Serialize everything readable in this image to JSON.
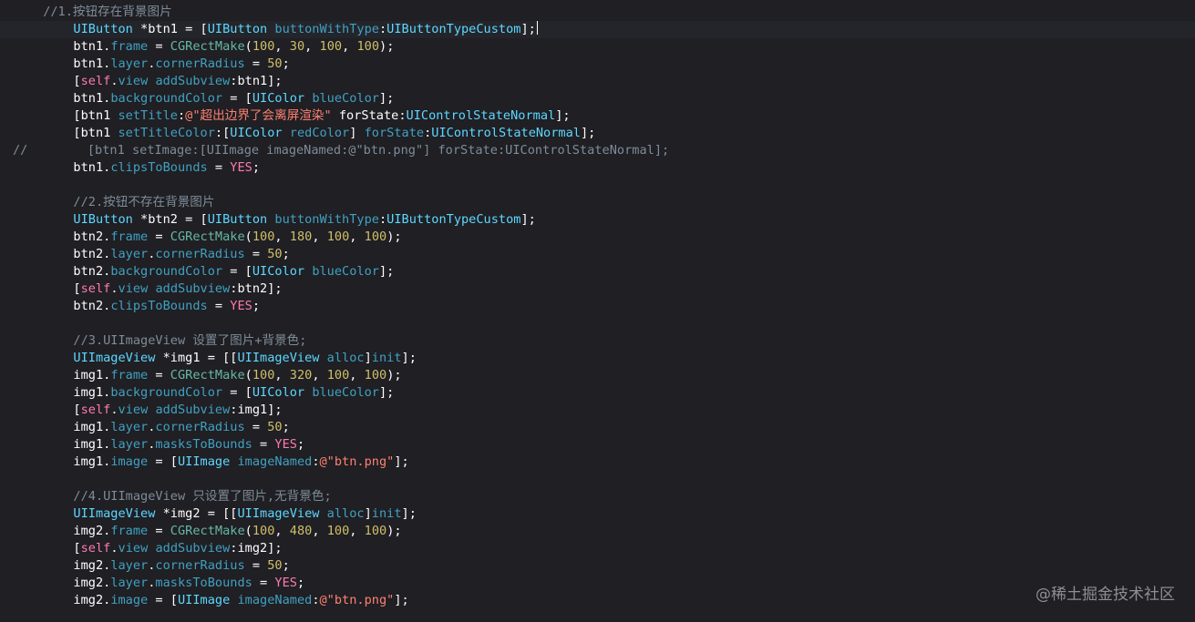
{
  "colors": {
    "background": "#1f1f24",
    "plain": "#ffffff",
    "type": "#5dd8ff",
    "project": "#41a1c0",
    "number": "#d0bf69",
    "keyword": "#ff7ab2",
    "string": "#ff8170",
    "comment": "#7f8c98"
  },
  "lines": [
    {
      "indent": "    ",
      "tokens": [
        {
          "t": "//1.按钮存在背景图片",
          "c": "comment"
        }
      ]
    },
    {
      "indent": "        ",
      "current": true,
      "cursor": true,
      "tokens": [
        {
          "t": "UIButton",
          "c": "type"
        },
        {
          "t": " *btn1 = [",
          "c": "plain"
        },
        {
          "t": "UIButton",
          "c": "type"
        },
        {
          "t": " ",
          "c": "plain"
        },
        {
          "t": "buttonWithType",
          "c": "method"
        },
        {
          "t": ":",
          "c": "plain"
        },
        {
          "t": "UIButtonTypeCustom",
          "c": "type"
        },
        {
          "t": "];",
          "c": "plain"
        }
      ]
    },
    {
      "indent": "        ",
      "tokens": [
        {
          "t": "btn1.",
          "c": "plain"
        },
        {
          "t": "frame",
          "c": "prop"
        },
        {
          "t": " = ",
          "c": "plain"
        },
        {
          "t": "CGRectMake",
          "c": "func"
        },
        {
          "t": "(",
          "c": "plain"
        },
        {
          "t": "100",
          "c": "number"
        },
        {
          "t": ", ",
          "c": "plain"
        },
        {
          "t": "30",
          "c": "number"
        },
        {
          "t": ", ",
          "c": "plain"
        },
        {
          "t": "100",
          "c": "number"
        },
        {
          "t": ", ",
          "c": "plain"
        },
        {
          "t": "100",
          "c": "number"
        },
        {
          "t": ");",
          "c": "plain"
        }
      ]
    },
    {
      "indent": "        ",
      "tokens": [
        {
          "t": "btn1.",
          "c": "plain"
        },
        {
          "t": "layer",
          "c": "prop"
        },
        {
          "t": ".",
          "c": "plain"
        },
        {
          "t": "cornerRadius",
          "c": "prop"
        },
        {
          "t": " = ",
          "c": "plain"
        },
        {
          "t": "50",
          "c": "number"
        },
        {
          "t": ";",
          "c": "plain"
        }
      ]
    },
    {
      "indent": "        ",
      "tokens": [
        {
          "t": "[",
          "c": "plain"
        },
        {
          "t": "self",
          "c": "keyword"
        },
        {
          "t": ".",
          "c": "plain"
        },
        {
          "t": "view",
          "c": "prop"
        },
        {
          "t": " ",
          "c": "plain"
        },
        {
          "t": "addSubview",
          "c": "method"
        },
        {
          "t": ":btn1];",
          "c": "plain"
        }
      ]
    },
    {
      "indent": "        ",
      "tokens": [
        {
          "t": "btn1.",
          "c": "plain"
        },
        {
          "t": "backgroundColor",
          "c": "prop"
        },
        {
          "t": " = [",
          "c": "plain"
        },
        {
          "t": "UIColor",
          "c": "type"
        },
        {
          "t": " ",
          "c": "plain"
        },
        {
          "t": "blueColor",
          "c": "method"
        },
        {
          "t": "];",
          "c": "plain"
        }
      ]
    },
    {
      "indent": "        ",
      "tokens": [
        {
          "t": "[btn1 ",
          "c": "plain"
        },
        {
          "t": "setTitle",
          "c": "method"
        },
        {
          "t": ":",
          "c": "plain"
        },
        {
          "t": "@\"超出边界了会离屏渲染\"",
          "c": "string"
        },
        {
          "t": " forState:",
          "c": "plain"
        },
        {
          "t": "UIControlStateNormal",
          "c": "type"
        },
        {
          "t": "];",
          "c": "plain"
        }
      ]
    },
    {
      "indent": "        ",
      "tokens": [
        {
          "t": "[btn1 ",
          "c": "plain"
        },
        {
          "t": "setTitleColor",
          "c": "method"
        },
        {
          "t": ":[",
          "c": "plain"
        },
        {
          "t": "UIColor",
          "c": "type"
        },
        {
          "t": " ",
          "c": "plain"
        },
        {
          "t": "redColor",
          "c": "method"
        },
        {
          "t": "] ",
          "c": "plain"
        },
        {
          "t": "forState",
          "c": "method"
        },
        {
          "t": ":",
          "c": "plain"
        },
        {
          "t": "UIControlStateNormal",
          "c": "type"
        },
        {
          "t": "];",
          "c": "plain"
        }
      ]
    },
    {
      "indent": "",
      "tokens": [
        {
          "t": "//        [btn1 setImage:[UIImage imageNamed:@\"btn.png\"] forState:UIControlStateNormal];",
          "c": "comment"
        }
      ]
    },
    {
      "indent": "        ",
      "tokens": [
        {
          "t": "btn1.",
          "c": "plain"
        },
        {
          "t": "clipsToBounds",
          "c": "prop"
        },
        {
          "t": " = ",
          "c": "plain"
        },
        {
          "t": "YES",
          "c": "keyword"
        },
        {
          "t": ";",
          "c": "plain"
        }
      ]
    },
    {
      "indent": "",
      "tokens": []
    },
    {
      "indent": "        ",
      "tokens": [
        {
          "t": "//2.按钮不存在背景图片",
          "c": "comment"
        }
      ]
    },
    {
      "indent": "        ",
      "tokens": [
        {
          "t": "UIButton",
          "c": "type"
        },
        {
          "t": " *btn2 = [",
          "c": "plain"
        },
        {
          "t": "UIButton",
          "c": "type"
        },
        {
          "t": " ",
          "c": "plain"
        },
        {
          "t": "buttonWithType",
          "c": "method"
        },
        {
          "t": ":",
          "c": "plain"
        },
        {
          "t": "UIButtonTypeCustom",
          "c": "type"
        },
        {
          "t": "];",
          "c": "plain"
        }
      ]
    },
    {
      "indent": "        ",
      "tokens": [
        {
          "t": "btn2.",
          "c": "plain"
        },
        {
          "t": "frame",
          "c": "prop"
        },
        {
          "t": " = ",
          "c": "plain"
        },
        {
          "t": "CGRectMake",
          "c": "func"
        },
        {
          "t": "(",
          "c": "plain"
        },
        {
          "t": "100",
          "c": "number"
        },
        {
          "t": ", ",
          "c": "plain"
        },
        {
          "t": "180",
          "c": "number"
        },
        {
          "t": ", ",
          "c": "plain"
        },
        {
          "t": "100",
          "c": "number"
        },
        {
          "t": ", ",
          "c": "plain"
        },
        {
          "t": "100",
          "c": "number"
        },
        {
          "t": ");",
          "c": "plain"
        }
      ]
    },
    {
      "indent": "        ",
      "tokens": [
        {
          "t": "btn2.",
          "c": "plain"
        },
        {
          "t": "layer",
          "c": "prop"
        },
        {
          "t": ".",
          "c": "plain"
        },
        {
          "t": "cornerRadius",
          "c": "prop"
        },
        {
          "t": " = ",
          "c": "plain"
        },
        {
          "t": "50",
          "c": "number"
        },
        {
          "t": ";",
          "c": "plain"
        }
      ]
    },
    {
      "indent": "        ",
      "tokens": [
        {
          "t": "btn2.",
          "c": "plain"
        },
        {
          "t": "backgroundColor",
          "c": "prop"
        },
        {
          "t": " = [",
          "c": "plain"
        },
        {
          "t": "UIColor",
          "c": "type"
        },
        {
          "t": " ",
          "c": "plain"
        },
        {
          "t": "blueColor",
          "c": "method"
        },
        {
          "t": "];",
          "c": "plain"
        }
      ]
    },
    {
      "indent": "        ",
      "tokens": [
        {
          "t": "[",
          "c": "plain"
        },
        {
          "t": "self",
          "c": "keyword"
        },
        {
          "t": ".",
          "c": "plain"
        },
        {
          "t": "view",
          "c": "prop"
        },
        {
          "t": " ",
          "c": "plain"
        },
        {
          "t": "addSubview",
          "c": "method"
        },
        {
          "t": ":btn2];",
          "c": "plain"
        }
      ]
    },
    {
      "indent": "        ",
      "tokens": [
        {
          "t": "btn2.",
          "c": "plain"
        },
        {
          "t": "clipsToBounds",
          "c": "prop"
        },
        {
          "t": " = ",
          "c": "plain"
        },
        {
          "t": "YES",
          "c": "keyword"
        },
        {
          "t": ";",
          "c": "plain"
        }
      ]
    },
    {
      "indent": "",
      "tokens": []
    },
    {
      "indent": "        ",
      "tokens": [
        {
          "t": "//3.UIImageView 设置了图片+背景色;",
          "c": "comment"
        }
      ]
    },
    {
      "indent": "        ",
      "tokens": [
        {
          "t": "UIImageView",
          "c": "type"
        },
        {
          "t": " *img1 = [[",
          "c": "plain"
        },
        {
          "t": "UIImageView",
          "c": "type"
        },
        {
          "t": " ",
          "c": "plain"
        },
        {
          "t": "alloc",
          "c": "method"
        },
        {
          "t": "]",
          "c": "plain"
        },
        {
          "t": "init",
          "c": "method"
        },
        {
          "t": "];",
          "c": "plain"
        }
      ]
    },
    {
      "indent": "        ",
      "tokens": [
        {
          "t": "img1.",
          "c": "plain"
        },
        {
          "t": "frame",
          "c": "prop"
        },
        {
          "t": " = ",
          "c": "plain"
        },
        {
          "t": "CGRectMake",
          "c": "func"
        },
        {
          "t": "(",
          "c": "plain"
        },
        {
          "t": "100",
          "c": "number"
        },
        {
          "t": ", ",
          "c": "plain"
        },
        {
          "t": "320",
          "c": "number"
        },
        {
          "t": ", ",
          "c": "plain"
        },
        {
          "t": "100",
          "c": "number"
        },
        {
          "t": ", ",
          "c": "plain"
        },
        {
          "t": "100",
          "c": "number"
        },
        {
          "t": ");",
          "c": "plain"
        }
      ]
    },
    {
      "indent": "        ",
      "tokens": [
        {
          "t": "img1.",
          "c": "plain"
        },
        {
          "t": "backgroundColor",
          "c": "prop"
        },
        {
          "t": " = [",
          "c": "plain"
        },
        {
          "t": "UIColor",
          "c": "type"
        },
        {
          "t": " ",
          "c": "plain"
        },
        {
          "t": "blueColor",
          "c": "method"
        },
        {
          "t": "];",
          "c": "plain"
        }
      ]
    },
    {
      "indent": "        ",
      "tokens": [
        {
          "t": "[",
          "c": "plain"
        },
        {
          "t": "self",
          "c": "keyword"
        },
        {
          "t": ".",
          "c": "plain"
        },
        {
          "t": "view",
          "c": "prop"
        },
        {
          "t": " ",
          "c": "plain"
        },
        {
          "t": "addSubview",
          "c": "method"
        },
        {
          "t": ":img1];",
          "c": "plain"
        }
      ]
    },
    {
      "indent": "        ",
      "tokens": [
        {
          "t": "img1.",
          "c": "plain"
        },
        {
          "t": "layer",
          "c": "prop"
        },
        {
          "t": ".",
          "c": "plain"
        },
        {
          "t": "cornerRadius",
          "c": "prop"
        },
        {
          "t": " = ",
          "c": "plain"
        },
        {
          "t": "50",
          "c": "number"
        },
        {
          "t": ";",
          "c": "plain"
        }
      ]
    },
    {
      "indent": "        ",
      "tokens": [
        {
          "t": "img1.",
          "c": "plain"
        },
        {
          "t": "layer",
          "c": "prop"
        },
        {
          "t": ".",
          "c": "plain"
        },
        {
          "t": "masksToBounds",
          "c": "prop"
        },
        {
          "t": " = ",
          "c": "plain"
        },
        {
          "t": "YES",
          "c": "keyword"
        },
        {
          "t": ";",
          "c": "plain"
        }
      ]
    },
    {
      "indent": "        ",
      "tokens": [
        {
          "t": "img1.",
          "c": "plain"
        },
        {
          "t": "image",
          "c": "prop"
        },
        {
          "t": " = [",
          "c": "plain"
        },
        {
          "t": "UIImage",
          "c": "type"
        },
        {
          "t": " ",
          "c": "plain"
        },
        {
          "t": "imageNamed",
          "c": "method"
        },
        {
          "t": ":",
          "c": "plain"
        },
        {
          "t": "@\"btn.png\"",
          "c": "string"
        },
        {
          "t": "];",
          "c": "plain"
        }
      ]
    },
    {
      "indent": "",
      "tokens": []
    },
    {
      "indent": "        ",
      "tokens": [
        {
          "t": "//4.UIImageView 只设置了图片,无背景色;",
          "c": "comment"
        }
      ]
    },
    {
      "indent": "        ",
      "tokens": [
        {
          "t": "UIImageView",
          "c": "type"
        },
        {
          "t": " *img2 = [[",
          "c": "plain"
        },
        {
          "t": "UIImageView",
          "c": "type"
        },
        {
          "t": " ",
          "c": "plain"
        },
        {
          "t": "alloc",
          "c": "method"
        },
        {
          "t": "]",
          "c": "plain"
        },
        {
          "t": "init",
          "c": "method"
        },
        {
          "t": "];",
          "c": "plain"
        }
      ]
    },
    {
      "indent": "        ",
      "tokens": [
        {
          "t": "img2.",
          "c": "plain"
        },
        {
          "t": "frame",
          "c": "prop"
        },
        {
          "t": " = ",
          "c": "plain"
        },
        {
          "t": "CGRectMake",
          "c": "func"
        },
        {
          "t": "(",
          "c": "plain"
        },
        {
          "t": "100",
          "c": "number"
        },
        {
          "t": ", ",
          "c": "plain"
        },
        {
          "t": "480",
          "c": "number"
        },
        {
          "t": ", ",
          "c": "plain"
        },
        {
          "t": "100",
          "c": "number"
        },
        {
          "t": ", ",
          "c": "plain"
        },
        {
          "t": "100",
          "c": "number"
        },
        {
          "t": ");",
          "c": "plain"
        }
      ]
    },
    {
      "indent": "        ",
      "tokens": [
        {
          "t": "[",
          "c": "plain"
        },
        {
          "t": "self",
          "c": "keyword"
        },
        {
          "t": ".",
          "c": "plain"
        },
        {
          "t": "view",
          "c": "prop"
        },
        {
          "t": " ",
          "c": "plain"
        },
        {
          "t": "addSubview",
          "c": "method"
        },
        {
          "t": ":img2];",
          "c": "plain"
        }
      ]
    },
    {
      "indent": "        ",
      "tokens": [
        {
          "t": "img2.",
          "c": "plain"
        },
        {
          "t": "layer",
          "c": "prop"
        },
        {
          "t": ".",
          "c": "plain"
        },
        {
          "t": "cornerRadius",
          "c": "prop"
        },
        {
          "t": " = ",
          "c": "plain"
        },
        {
          "t": "50",
          "c": "number"
        },
        {
          "t": ";",
          "c": "plain"
        }
      ]
    },
    {
      "indent": "        ",
      "tokens": [
        {
          "t": "img2.",
          "c": "plain"
        },
        {
          "t": "layer",
          "c": "prop"
        },
        {
          "t": ".",
          "c": "plain"
        },
        {
          "t": "masksToBounds",
          "c": "prop"
        },
        {
          "t": " = ",
          "c": "plain"
        },
        {
          "t": "YES",
          "c": "keyword"
        },
        {
          "t": ";",
          "c": "plain"
        }
      ]
    },
    {
      "indent": "        ",
      "tokens": [
        {
          "t": "img2.",
          "c": "plain"
        },
        {
          "t": "image",
          "c": "prop"
        },
        {
          "t": " = [",
          "c": "plain"
        },
        {
          "t": "UIImage",
          "c": "type"
        },
        {
          "t": " ",
          "c": "plain"
        },
        {
          "t": "imageNamed",
          "c": "method"
        },
        {
          "t": ":",
          "c": "plain"
        },
        {
          "t": "@\"btn.png\"",
          "c": "string"
        },
        {
          "t": "];",
          "c": "plain"
        }
      ]
    }
  ],
  "watermark": "@稀土掘金技术社区"
}
